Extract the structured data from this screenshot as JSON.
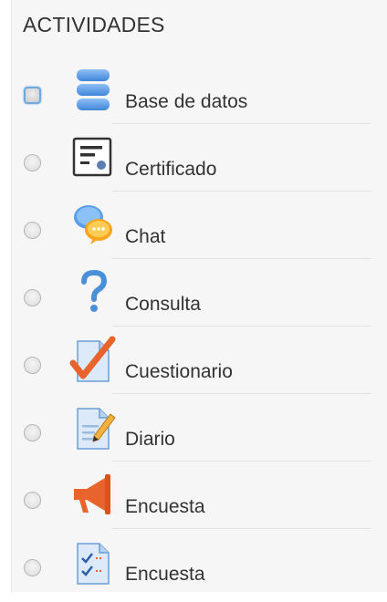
{
  "section": {
    "title": "ACTIVIDADES"
  },
  "activities": [
    {
      "label": "Base de datos",
      "icon": "database-icon",
      "selected": false
    },
    {
      "label": "Certificado",
      "icon": "certificate-icon",
      "selected": false
    },
    {
      "label": "Chat",
      "icon": "chat-icon",
      "selected": false
    },
    {
      "label": "Consulta",
      "icon": "question-icon",
      "selected": false
    },
    {
      "label": "Cuestionario",
      "icon": "quiz-icon",
      "selected": false
    },
    {
      "label": "Diario",
      "icon": "journal-icon",
      "selected": false
    },
    {
      "label": "Encuesta",
      "icon": "megaphone-icon",
      "selected": false
    },
    {
      "label": "Encuesta",
      "icon": "survey-icon",
      "selected": false
    }
  ],
  "colors": {
    "panel_background": "#f6f6f6",
    "text": "#333333",
    "accent_blue": "#4a90d9",
    "accent_orange": "#e8642c"
  }
}
